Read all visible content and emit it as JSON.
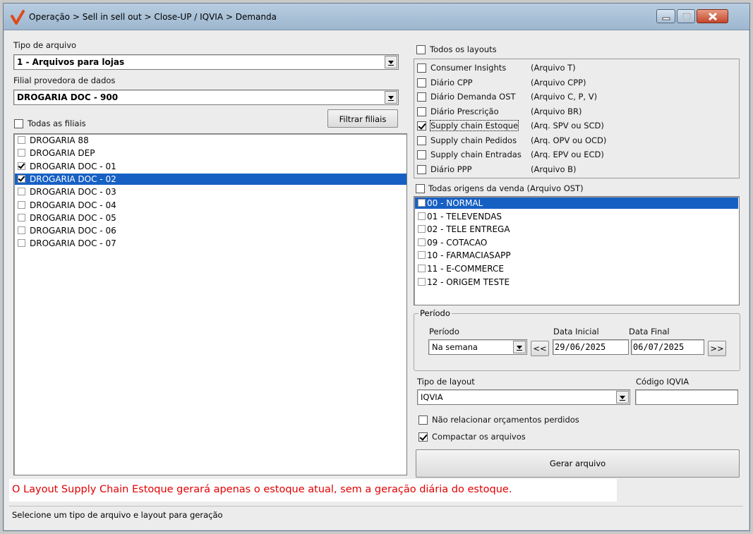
{
  "window": {
    "title": "Operação > Sell in sell out > Close-UP / IQVIA > Demanda"
  },
  "left": {
    "file_type_label": "Tipo de arquivo",
    "file_type_value": "1 - Arquivos para lojas",
    "provider_label": "Filial provedora de dados",
    "provider_value": "DROGARIA DOC - 900",
    "all_branches_label": "Todas as filiais",
    "all_branches_checked": false,
    "filter_button": "Filtrar filiais",
    "branches": [
      {
        "label": "DROGARIA 88",
        "checked": false,
        "selected": false
      },
      {
        "label": "DROGARIA DEP",
        "checked": false,
        "selected": false
      },
      {
        "label": "DROGARIA DOC - 01",
        "checked": true,
        "selected": false
      },
      {
        "label": "DROGARIA DOC - 02",
        "checked": true,
        "selected": true
      },
      {
        "label": "DROGARIA DOC - 03",
        "checked": false,
        "selected": false
      },
      {
        "label": "DROGARIA DOC - 04",
        "checked": false,
        "selected": false
      },
      {
        "label": "DROGARIA DOC - 05",
        "checked": false,
        "selected": false
      },
      {
        "label": "DROGARIA DOC - 06",
        "checked": false,
        "selected": false
      },
      {
        "label": "DROGARIA DOC - 07",
        "checked": false,
        "selected": false
      }
    ]
  },
  "layouts": {
    "all_label": "Todos os layouts",
    "all_checked": false,
    "items": [
      {
        "name": "Consumer Insights",
        "file": "(Arquivo T)",
        "checked": false
      },
      {
        "name": "Diário CPP",
        "file": "(Arquivo CPP)",
        "checked": false
      },
      {
        "name": "Diário Demanda OST",
        "file": "(Arquivo C, P, V)",
        "checked": false
      },
      {
        "name": "Diário Prescrição",
        "file": "(Arquivo BR)",
        "checked": false
      },
      {
        "name": "Supply chain Estoque",
        "file": "(Arq. SPV ou SCD)",
        "checked": true
      },
      {
        "name": "Supply chain Pedidos",
        "file": "(Arq. OPV ou OCD)",
        "checked": false
      },
      {
        "name": "Supply chain Entradas",
        "file": "(Arq. EPV ou ECD)",
        "checked": false
      },
      {
        "name": "Diário PPP",
        "file": "(Arquivo B)",
        "checked": false
      }
    ]
  },
  "origins": {
    "all_label": "Todas origens da venda (Arquivo OST)",
    "all_checked": false,
    "items": [
      {
        "label": "00 - NORMAL",
        "selected": true
      },
      {
        "label": "01 - TELEVENDAS",
        "selected": false
      },
      {
        "label": "02 - TELE ENTREGA",
        "selected": false
      },
      {
        "label": "09 - COTACAO",
        "selected": false
      },
      {
        "label": "10 - FARMACIASAPP",
        "selected": false
      },
      {
        "label": "11 - E-COMMERCE",
        "selected": false
      },
      {
        "label": "12 - ORIGEM TESTE",
        "selected": false
      }
    ]
  },
  "period": {
    "group_title": "Período",
    "period_label": "Período",
    "period_value": "Na semana",
    "prev_button": "<<",
    "next_button": ">>",
    "start_label": "Data Inicial",
    "start_value": "29/06/2025",
    "end_label": "Data Final",
    "end_value": "06/07/2025"
  },
  "layout_type": {
    "label": "Tipo de layout",
    "value": "IQVIA",
    "iqvia_code_label": "Código IQVIA",
    "iqvia_code_value": ""
  },
  "options": {
    "no_lost_quotes_label": "Não relacionar orçamentos perdidos",
    "no_lost_quotes_checked": false,
    "compress_label": "Compactar os arquivos",
    "compress_checked": true
  },
  "generate_button": "Gerar arquivo",
  "warning_text": "O Layout Supply Chain Estoque gerará apenas o estoque atual, sem a geração diária do estoque.",
  "status_text": "Selecione um tipo de arquivo e layout para geração",
  "colors": {
    "selection": "#1660c4",
    "warning": "#e00000",
    "logo": "#e04a1a"
  }
}
